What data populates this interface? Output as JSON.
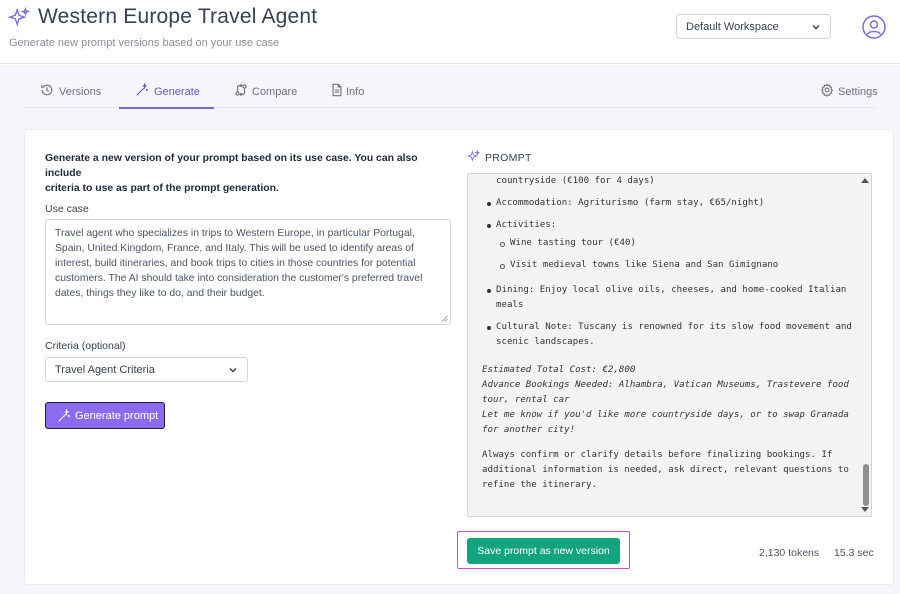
{
  "header": {
    "title": "Western Europe Travel Agent",
    "subtitle": "Generate new prompt versions based on your use case",
    "workspace": "Default Workspace"
  },
  "tabs": [
    {
      "label": "Versions"
    },
    {
      "label": "Generate"
    },
    {
      "label": "Compare"
    },
    {
      "label": "Info"
    }
  ],
  "settings_label": "Settings",
  "form": {
    "intro_line1": "Generate a new version of your prompt based on its use case. You can also include",
    "intro_line2": "criteria to use as part of the prompt generation.",
    "use_case_label": "Use case",
    "use_case_lines": [
      "Travel agent who specializes in trips to Western Europe, in particular Portugal,",
      "Spain, United Kingdom, France, and Italy. This will be used to identify areas of",
      "interest, build itineraries, and book trips to cities in those countries for potential",
      "customers. The AI should take into consideration the customer's preferred travel",
      "dates, things they like to do, and their budget."
    ],
    "criteria_label": "Criteria (optional)",
    "criteria_value": "Travel Agent Criteria",
    "generate_button": "Generate prompt"
  },
  "prompt": {
    "heading": "PROMPT",
    "lines": {
      "l0": "countryside (€100 for 4 days)",
      "l1": "Accommodation: Agriturismo (farm stay, €65/night)",
      "l2": "Activities:",
      "l3": "Wine tasting tour (€40)",
      "l4": "Visit medieval towns like Siena and San Gimignano",
      "l5a": "Dining: Enjoy local olive oils, cheeses, and home-cooked Italian",
      "l5b": "meals",
      "l6a": "Cultural Note: Tuscany is renowned for its slow food movement and",
      "l6b": "scenic landscapes.",
      "l7": "Estimated Total Cost: €2,800",
      "l8": "Advance Bookings Needed: Alhambra, Vatican Museums, Trastevere food",
      "l9": "tour, rental car",
      "l10": "Let me know if you'd like more countryside days, or to swap Granada",
      "l11": "for another city!",
      "l12": "Always confirm or clarify details before finalizing bookings. If",
      "l13": "additional information is needed, ask direct, relevant questions to",
      "l14": "refine the itinerary."
    },
    "save_button": "Save prompt as new version",
    "tokens": "2,130 tokens",
    "duration": "15.3 sec"
  },
  "colors": {
    "accent": "#7c6ad6",
    "button_purple": "#8b6cf0",
    "save_green": "#12a37f",
    "highlight_pink": "#e040c8"
  }
}
